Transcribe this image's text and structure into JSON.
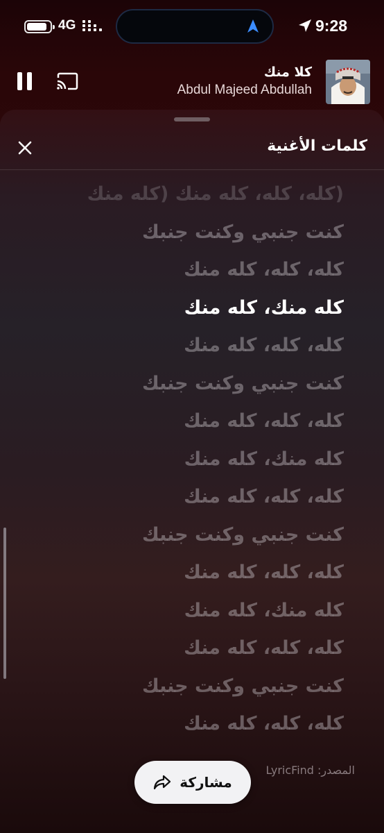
{
  "status_bar": {
    "network": "4G",
    "time": "9:28"
  },
  "now_playing": {
    "title": "كلا منك",
    "artist": "Abdul Majeed Abdullah"
  },
  "lyrics_sheet": {
    "title": "كلمات الأغنية",
    "lines": [
      "(كله، كله، كله منك (كله منك",
      "كنت جنبي وكنت جنبك",
      "كله، كله، كله منك",
      "كله منك، كله منك",
      "كله، كله، كله منك",
      "كنت جنبي وكنت جنبك",
      "كله، كله، كله منك",
      "كله منك، كله منك",
      "كله، كله، كله منك",
      "كنت جنبي وكنت جنبك",
      "كله، كله، كله منك",
      "كله منك، كله منك",
      "كله، كله، كله منك",
      "كنت جنبي وكنت جنبك",
      "كله، كله، كله منك"
    ],
    "active_line_index": 3,
    "source": "المصدر: LyricFind",
    "share_label": "مشاركة"
  }
}
